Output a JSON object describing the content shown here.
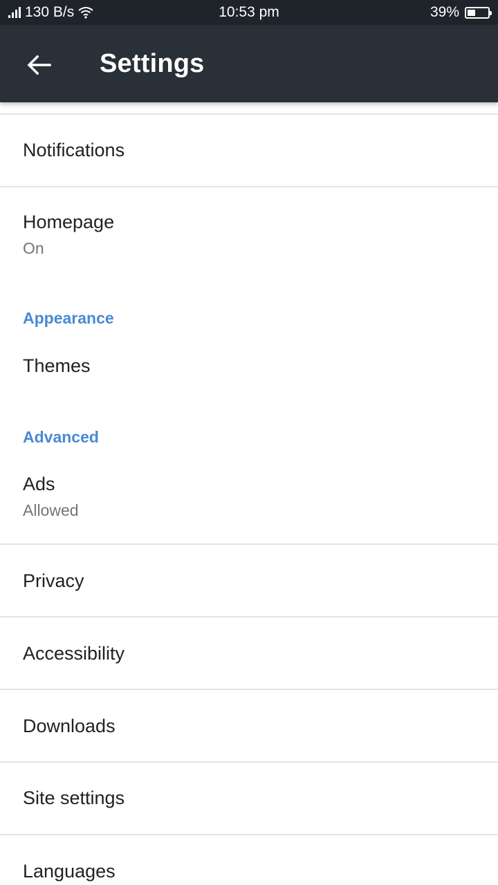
{
  "status_bar": {
    "net_speed": "130 B/s",
    "time": "10:53 pm",
    "battery_percent": "39%",
    "battery_level": 0.39
  },
  "app_bar": {
    "title": "Settings",
    "back_icon": "arrow-back-icon"
  },
  "items": {
    "notifications": {
      "title": "Notifications"
    },
    "homepage": {
      "title": "Homepage",
      "subtitle": "On"
    },
    "appearance_header": "Appearance",
    "themes": {
      "title": "Themes"
    },
    "advanced_header": "Advanced",
    "ads": {
      "title": "Ads",
      "subtitle": "Allowed"
    },
    "privacy": {
      "title": "Privacy"
    },
    "accessibility": {
      "title": "Accessibility"
    },
    "downloads": {
      "title": "Downloads"
    },
    "site_settings": {
      "title": "Site settings"
    },
    "languages": {
      "title": "Languages"
    }
  },
  "colors": {
    "status_bar_bg": "#1f242a",
    "app_bar_bg": "#2a3038",
    "section_header": "#4a8ad3",
    "divider": "#e4e4e4"
  }
}
